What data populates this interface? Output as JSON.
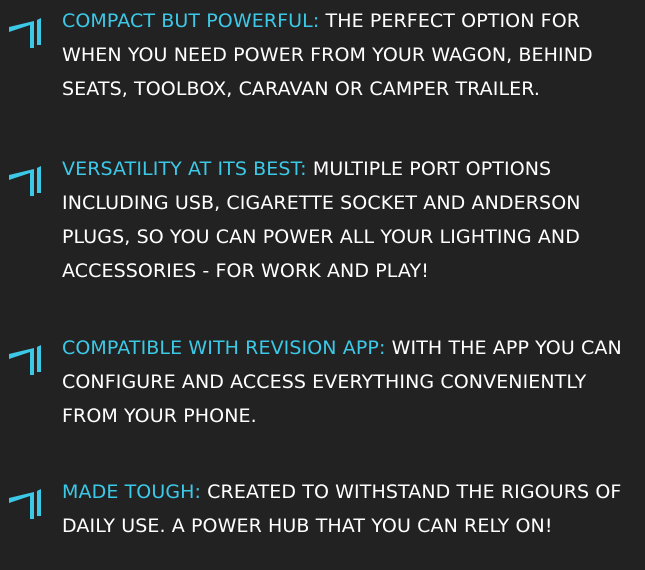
{
  "accent_color": "#3cc9e8",
  "text_color": "#ffffff",
  "background_color": "#222222",
  "icon": "angled-arrow-bullet-icon",
  "features": [
    {
      "lead": "COMPACT BUT POWERFUL:",
      "text": " THE PERFECT OPTION FOR WHEN YOU NEED POWER  FROM YOUR WAGON, BEHIND SEATS, TOOLBOX, CARAVAN OR CAMPER TRAILER."
    },
    {
      "lead": "VERSATILITY AT ITS BEST:",
      "text": " MULTIPLE PORT OPTIONS INCLUDING USB, CIGARETTE SOCKET AND ANDERSON PLUGS, SO YOU CAN POWER ALL YOUR  LIGHTING AND ACCESSORIES - FOR WORK AND PLAY!"
    },
    {
      "lead": "COMPATIBLE WITH REVISION APP:",
      "text": " WITH THE APP YOU CAN CONFIGURE AND ACCESS EVERYTHING CONVENIENTLY FROM YOUR PHONE."
    },
    {
      "lead": "MADE TOUGH:",
      "text": " CREATED TO WITHSTAND THE RIGOURS OF DAILY USE. A POWER HUB THAT YOU CAN RELY ON!"
    }
  ]
}
